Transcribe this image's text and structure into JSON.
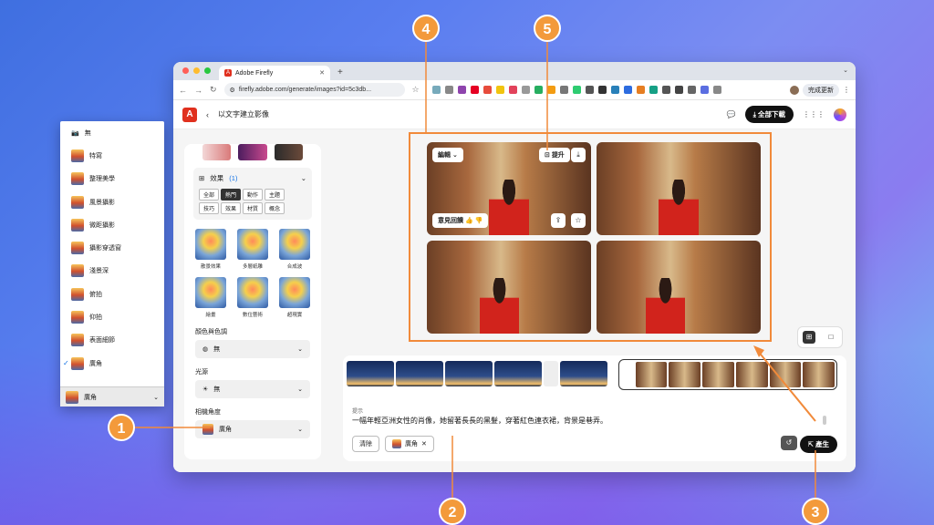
{
  "browser": {
    "tab_title": "Adobe Firefly",
    "url": "firefly.adobe.com/generate/images?id=5c3db...",
    "update_label": "完成更新"
  },
  "header": {
    "back_label": "以文字建立影像",
    "download_all": "全部下載"
  },
  "panel": {
    "effects": {
      "title": "效果",
      "count": "(1)",
      "chips": [
        "全部",
        "熱門",
        "動作",
        "主題",
        "技巧",
        "效果",
        "材質",
        "概念"
      ],
      "active_chip": "熱門",
      "items": [
        "散景效果",
        "多層紙雕",
        "合成波",
        "繪畫",
        "數位藝術",
        "超現實"
      ]
    },
    "color_tone": {
      "label": "顏色與色調",
      "value": "無"
    },
    "lighting": {
      "label": "光源",
      "value": "無"
    },
    "camera_angle": {
      "label": "相機角度",
      "value": "廣角"
    }
  },
  "gallery": {
    "edit_label": "編輯",
    "upscale_label": "提升",
    "feedback_label": "意見回饋"
  },
  "prompt": {
    "label": "提示",
    "text": "一幅年輕亞洲女性的肖像，她留著長長的黑髮，穿著紅色連衣裙，背景是巷弄。",
    "clear_label": "清除",
    "tag_label": "廣角",
    "generate_label": "產生"
  },
  "menu": {
    "items": [
      "無",
      "特寫",
      "整理美學",
      "風景攝影",
      "微距攝影",
      "攝影穿透窗",
      "淺景深",
      "俯拍",
      "仰拍",
      "表面細節",
      "廣角"
    ],
    "selected": "廣角"
  },
  "callouts": [
    "1",
    "2",
    "3",
    "4",
    "5"
  ],
  "colors": {
    "accent_orange": "#f39a3b",
    "adobe_red": "#e0301e",
    "link_blue": "#1473e6"
  }
}
